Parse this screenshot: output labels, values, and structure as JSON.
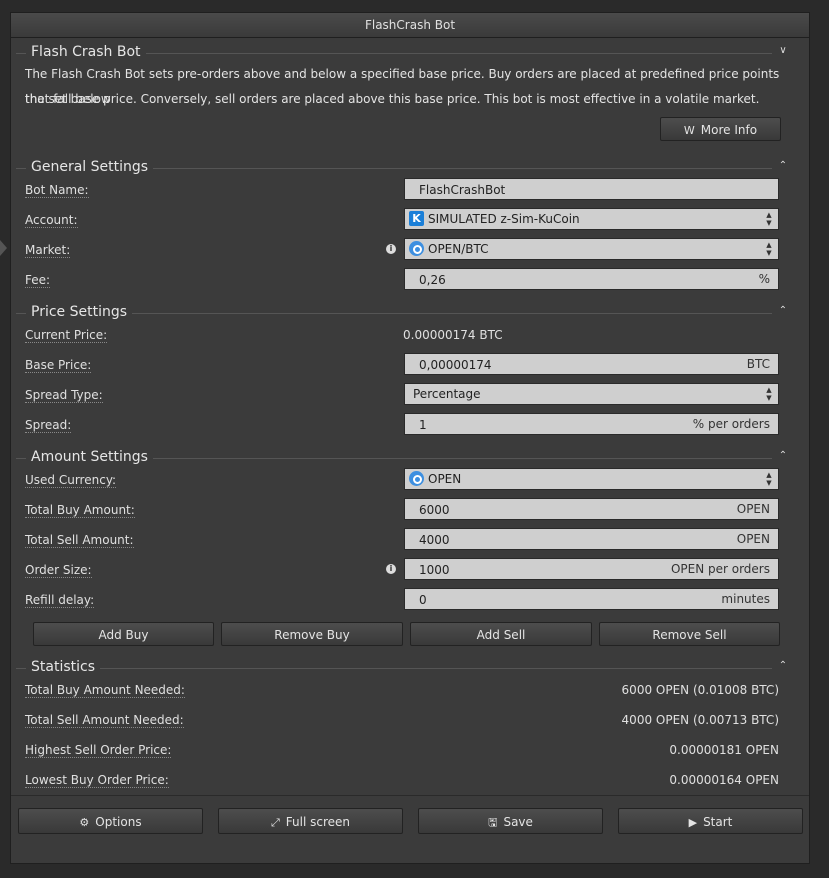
{
  "window": {
    "title": "FlashCrash Bot"
  },
  "intro": {
    "title": "Flash Crash Bot",
    "description_line1": "The Flash Crash Bot sets pre-orders above and below a specified base price. Buy orders are placed at predefined price points that fall below",
    "description_line2": "the set base price. Conversely, sell orders are placed above this base price. This bot is most effective in a volatile market.",
    "more_info_label": "More Info",
    "more_info_icon": "W"
  },
  "general": {
    "title": "General Settings",
    "bot_name_label": "Bot Name:",
    "bot_name_value": "FlashCrashBot",
    "account_label": "Account:",
    "account_value": "SIMULATED z-Sim-KuCoin",
    "market_label": "Market:",
    "market_value": "OPEN/BTC",
    "fee_label": "Fee:",
    "fee_value": "0,26",
    "fee_unit": "%"
  },
  "price": {
    "title": "Price Settings",
    "current_price_label": "Current Price:",
    "current_price_value": "0.00000174 BTC",
    "base_price_label": "Base Price:",
    "base_price_value": "0,00000174",
    "base_price_unit": "BTC",
    "spread_type_label": "Spread Type:",
    "spread_type_value": "Percentage",
    "spread_label": "Spread:",
    "spread_value": "1",
    "spread_unit": "% per orders"
  },
  "amount": {
    "title": "Amount Settings",
    "used_currency_label": "Used Currency:",
    "used_currency_value": "OPEN",
    "total_buy_label": "Total Buy Amount:",
    "total_buy_value": "6000",
    "total_buy_unit": "OPEN",
    "total_sell_label": "Total Sell Amount:",
    "total_sell_value": "4000",
    "total_sell_unit": "OPEN",
    "order_size_label": "Order Size:",
    "order_size_value": "1000",
    "order_size_unit": "OPEN per orders",
    "refill_delay_label": "Refill delay:",
    "refill_delay_value": "0",
    "refill_delay_unit": "minutes",
    "add_buy_label": "Add Buy",
    "remove_buy_label": "Remove Buy",
    "add_sell_label": "Add Sell",
    "remove_sell_label": "Remove Sell"
  },
  "statistics": {
    "title": "Statistics",
    "rows": [
      {
        "label": "Total Buy Amount Needed:",
        "value": "6000 OPEN (0.01008 BTC)"
      },
      {
        "label": "Total Sell Amount Needed:",
        "value": "4000 OPEN (0.00713 BTC)"
      },
      {
        "label": "Highest Sell Order Price:",
        "value": "0.00000181 OPEN"
      },
      {
        "label": "Lowest Buy Order Price:",
        "value": "0.00000164 OPEN"
      }
    ]
  },
  "footer": {
    "options_label": "Options",
    "fullscreen_label": "Full screen",
    "save_label": "Save",
    "start_label": "Start"
  },
  "icons": {
    "collapse": "chevrons-down-icon",
    "expand": "chevrons-up-icon",
    "info": "info-icon",
    "gear": "gear-icon",
    "expand_arrows": "expand-icon",
    "save": "floppy-disk-icon",
    "play": "play-icon"
  },
  "colors": {
    "background": "#2a2a2a",
    "panel": "#3b3b3b",
    "field": "#cfcfcf",
    "kucoin": "#1a7fd8",
    "open_token": "#3d8fe0"
  }
}
